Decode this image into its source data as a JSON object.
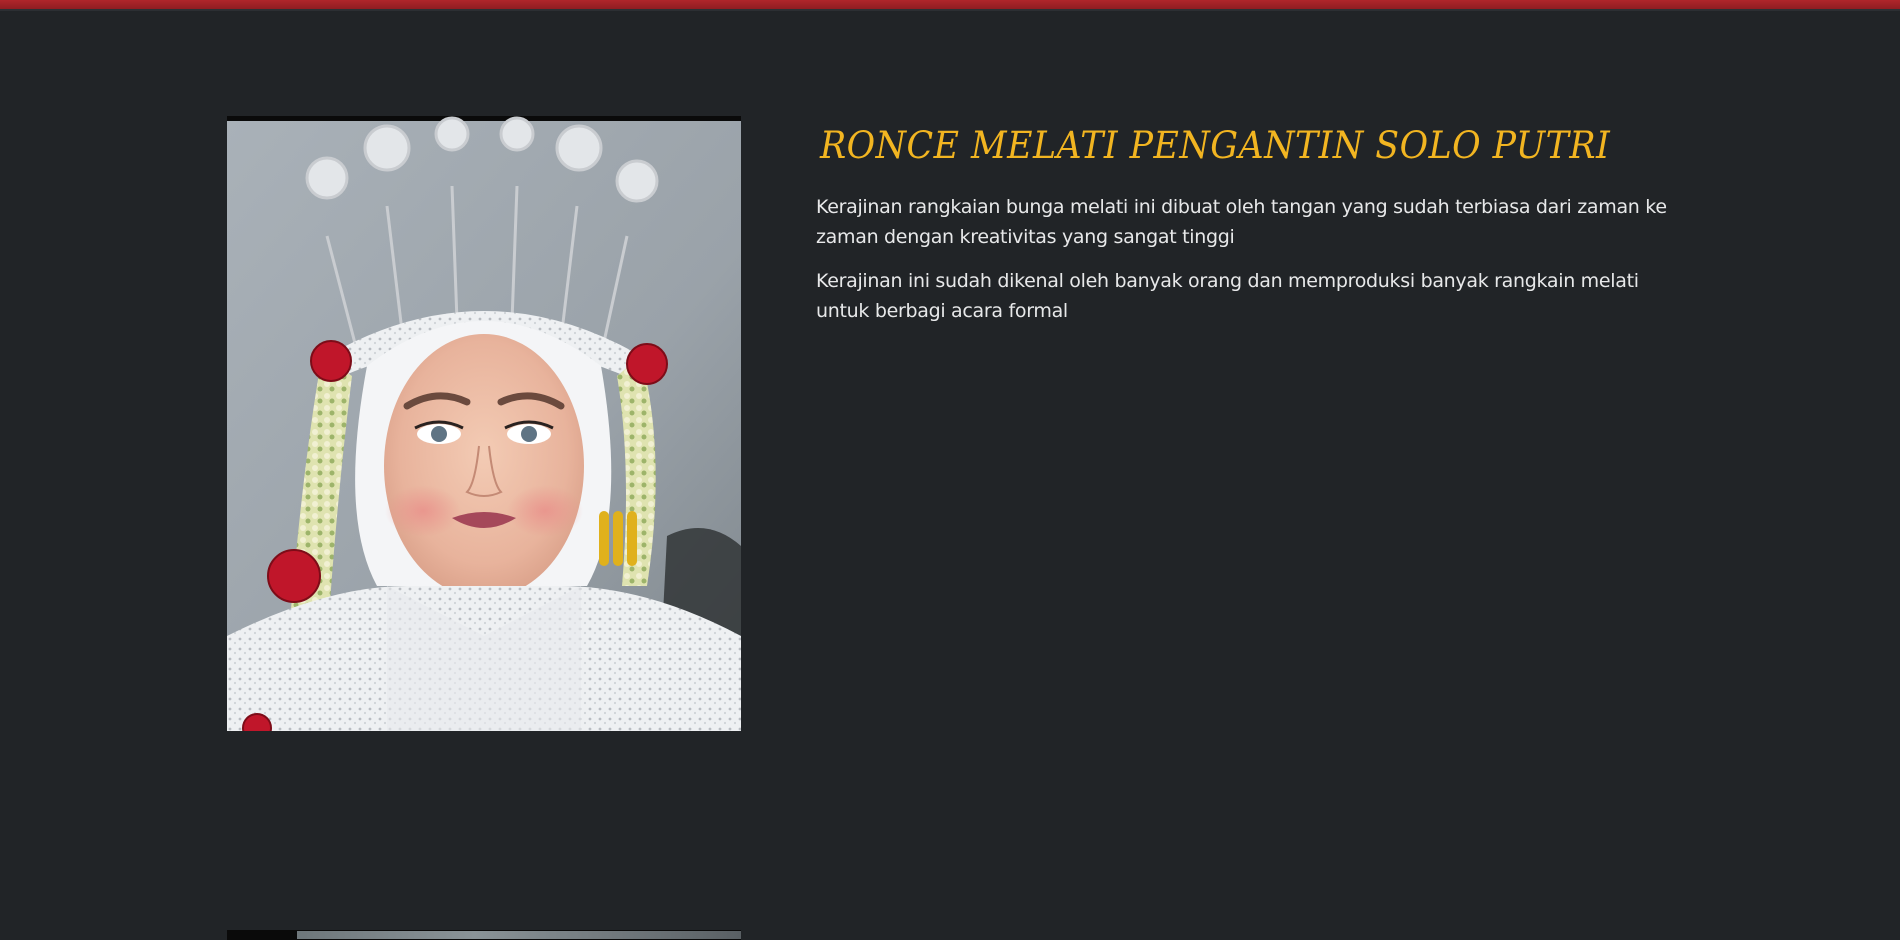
{
  "product": {
    "title": "RONCE MELATI PENGANTIN SOLO PUTRI",
    "paragraphs": [
      "Kerajinan rangkaian bunga melati ini dibuat oleh tangan yang sudah terbiasa dari zaman ke zaman dengan kreativitas yang sangat tinggi",
      "Kerajinan ini sudah dikenal oleh banyak orang dan memproduksi banyak rangkain melati untuk berbagi acara formal"
    ]
  },
  "colors": {
    "background": "#212427",
    "accent_bar": "#b0262b",
    "title": "#f2b521",
    "body_text": "#e7e8e9"
  }
}
